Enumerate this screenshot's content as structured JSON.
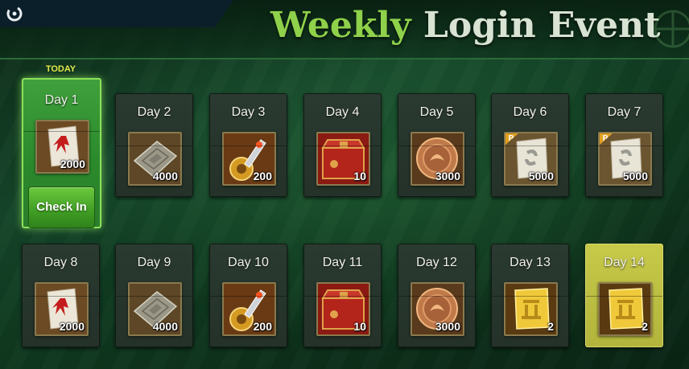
{
  "title": {
    "part1": "Weekly",
    "part2": "Login Event"
  },
  "today_label": "TODAY",
  "check_in_label": "Check In",
  "days": [
    {
      "label": "Day 1",
      "qty": "2000",
      "item": "red-scroll",
      "premium": false
    },
    {
      "label": "Day 2",
      "qty": "4000",
      "item": "stone-tablet",
      "premium": false
    },
    {
      "label": "Day 3",
      "qty": "200",
      "item": "golden-relic",
      "premium": false
    },
    {
      "label": "Day 4",
      "qty": "10",
      "item": "red-chest",
      "premium": false
    },
    {
      "label": "Day 5",
      "qty": "3000",
      "item": "bronze-coin",
      "premium": false
    },
    {
      "label": "Day 6",
      "qty": "5000",
      "item": "silver-scroll",
      "premium": true
    },
    {
      "label": "Day 7",
      "qty": "5000",
      "item": "silver-scroll",
      "premium": true
    },
    {
      "label": "Day 8",
      "qty": "2000",
      "item": "red-scroll",
      "premium": false
    },
    {
      "label": "Day 9",
      "qty": "4000",
      "item": "stone-tablet",
      "premium": false
    },
    {
      "label": "Day 10",
      "qty": "200",
      "item": "golden-relic",
      "premium": false
    },
    {
      "label": "Day 11",
      "qty": "10",
      "item": "red-chest",
      "premium": false
    },
    {
      "label": "Day 12",
      "qty": "3000",
      "item": "bronze-coin",
      "premium": false
    },
    {
      "label": "Day 13",
      "qty": "2",
      "item": "gold-scroll",
      "premium": false
    },
    {
      "label": "Day 14",
      "qty": "2",
      "item": "gold-scroll",
      "premium": false
    }
  ],
  "premium_badge": "P",
  "colors": {
    "accent_green": "#8fd14a",
    "today_border": "#8de05b",
    "final_card": "#c7c949"
  }
}
